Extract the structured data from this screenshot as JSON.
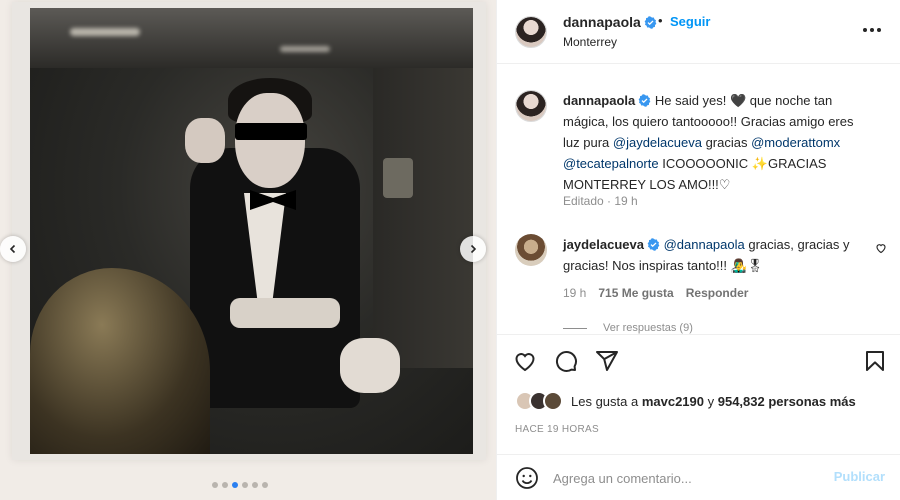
{
  "post": {
    "username": "dannapaola",
    "separator": "•",
    "follow_label": "Seguir",
    "location": "Monterrey",
    "caption_user": "dannapaola",
    "caption_part1": " He said yes! 🖤 que noche tan mágica, los quiero tantooooo!! Gracias amigo eres luz pura ",
    "mention1": "@jaydelacueva",
    "caption_part2": " gracias ",
    "mention2": "@moderattomx",
    "caption_part3": " ",
    "mention3": "@tecatepalnorte",
    "caption_part4": " ICOOOOONIC ✨GRACIAS MONTERREY LOS AMO!!!♡",
    "edited": "Editado · 19 h"
  },
  "comment": {
    "user": "jaydelacueva",
    "mention": "@dannapaola",
    "text": " gracias, gracias y gracias! Nos inspiras tanto!!! 👨‍🎤🎖",
    "time": "19 h",
    "likes": "715 Me gusta",
    "reply_label": "Responder",
    "view_replies": "Ver respuestas (9)"
  },
  "likes": {
    "prefix": "Les gusta a ",
    "user": "mavc2190",
    "middle": " y ",
    "count": "954,832 personas más"
  },
  "time_ago": "HACE 19 HORAS",
  "composer": {
    "placeholder": "Agrega un comentario...",
    "publish_label": "Publicar"
  },
  "carousel": {
    "total": 6,
    "active_index": 2
  },
  "colors": {
    "accent": "#0095f6",
    "mention": "#00376b",
    "publish_disabled": "#b2dffc",
    "active_dot": "#2a7ff0"
  },
  "icons": [
    "heart-icon",
    "comment-icon",
    "share-icon",
    "bookmark-icon",
    "emoji-icon",
    "verified-icon",
    "more-icon",
    "chevron-left-icon",
    "chevron-right-icon"
  ]
}
